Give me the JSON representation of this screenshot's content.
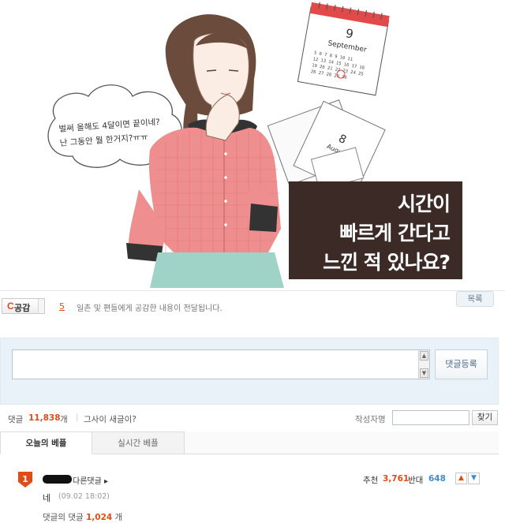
{
  "hero": {
    "thought_line1": "벌써 올해도 4달이면 끝이네?",
    "thought_line2": "난 그동안 뭘 한거지?ㅠㅠ",
    "calendar_day": "9",
    "calendar_month": "September",
    "calendar_back_day": "8",
    "calendar_back_month": "August",
    "caption_line1": "시간이",
    "caption_line2": "빠르게 간다고",
    "caption_line3": "느낀 적 있나요?"
  },
  "empathy": {
    "label": "공감",
    "badge": "C",
    "count": "5",
    "description": "일촌 및 편들에게 공감한 내용이 전달됩니다.",
    "list_button": "목록"
  },
  "comment_form": {
    "submit_label": "댓글등록"
  },
  "stats": {
    "comment_label": "댓글",
    "comment_count": "11,838",
    "comment_unit": "개",
    "separator": "|",
    "new_comment_text": "그사이 새글이?",
    "author_label": "작성자명",
    "find_button": "찾기"
  },
  "tabs": [
    {
      "label": "오늘의 베플"
    },
    {
      "label": "실시간 베플"
    }
  ],
  "best_comment": {
    "rank": "1",
    "other_comments": "다른댓글 ▸",
    "recommend_label": "추천",
    "recommend_count": "3,761",
    "oppose_label": "반대",
    "oppose_count": "648",
    "body": "네",
    "time": "(09.02 18:02)",
    "reply_prefix": "댓글의 댓글",
    "reply_count": "1,024",
    "reply_unit": "개"
  },
  "colors": {
    "accent": "#e34b16",
    "oppose": "#3c8fd6",
    "caption_bg": "#3b2a25",
    "write_bg": "#e9f2f9"
  }
}
